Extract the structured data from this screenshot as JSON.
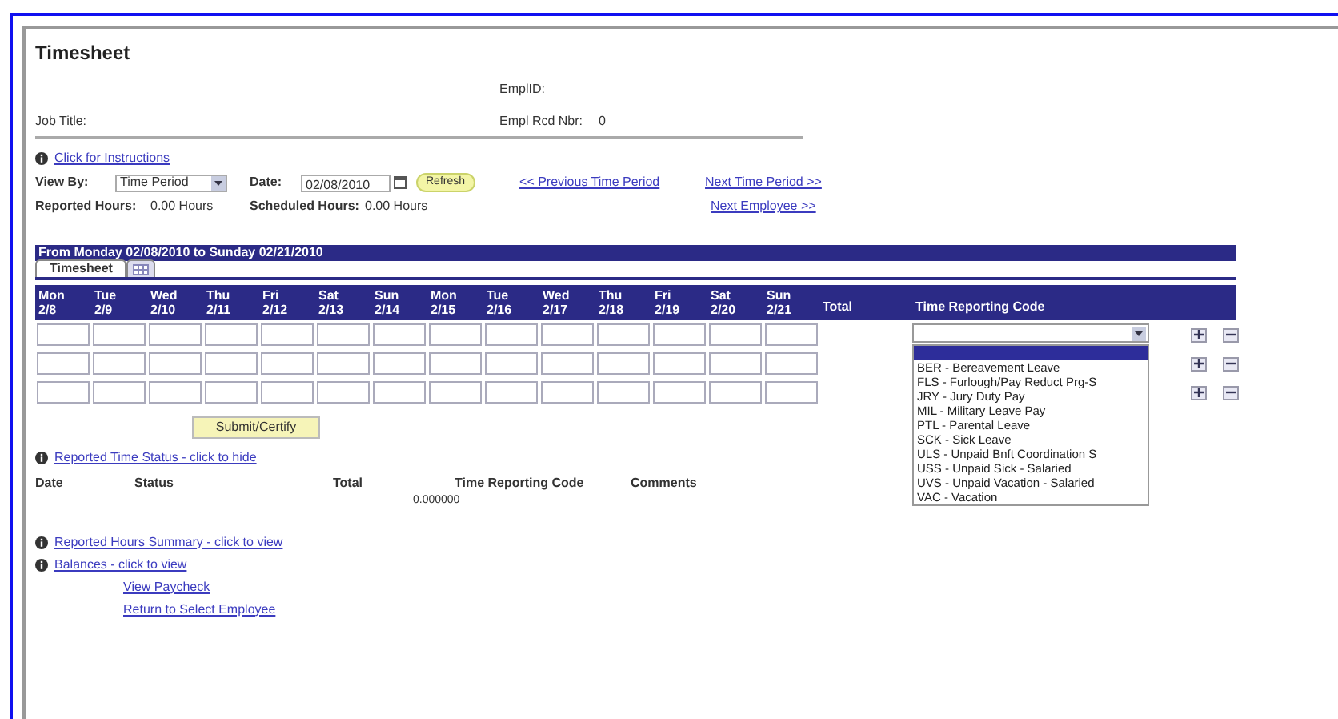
{
  "page": {
    "title": "Timesheet"
  },
  "employee": {
    "empl_id_label": "EmplID:",
    "job_title_label": "Job Title:",
    "empl_rcd_label": "Empl Rcd Nbr:",
    "empl_rcd_value": "0"
  },
  "instructions_link": "Click for Instructions",
  "controls": {
    "view_by_label": "View By:",
    "view_by_value": "Time Period",
    "date_label": "Date:",
    "date_value": "02/08/2010",
    "refresh_label": "Refresh",
    "previous_link": "<< Previous Time Period",
    "next_link": "Next Time Period >>",
    "reported_label": "Reported Hours:",
    "reported_value": "0.00 Hours",
    "scheduled_label": "Scheduled Hours:",
    "scheduled_value": "0.00 Hours",
    "next_employee_link": "Next Employee >>"
  },
  "period_banner": "From Monday 02/08/2010 to Sunday 02/21/2010",
  "tabs": [
    {
      "kind": "text",
      "label": "Timesheet",
      "selected": true
    },
    {
      "kind": "icon",
      "selected": false
    }
  ],
  "grid": {
    "days": [
      {
        "day": "Mon",
        "date": "2/8"
      },
      {
        "day": "Tue",
        "date": "2/9"
      },
      {
        "day": "Wed",
        "date": "2/10"
      },
      {
        "day": "Thu",
        "date": "2/11"
      },
      {
        "day": "Fri",
        "date": "2/12"
      },
      {
        "day": "Sat",
        "date": "2/13"
      },
      {
        "day": "Sun",
        "date": "2/14"
      },
      {
        "day": "Mon",
        "date": "2/15"
      },
      {
        "day": "Tue",
        "date": "2/16"
      },
      {
        "day": "Wed",
        "date": "2/17"
      },
      {
        "day": "Thu",
        "date": "2/18"
      },
      {
        "day": "Fri",
        "date": "2/19"
      },
      {
        "day": "Sat",
        "date": "2/20"
      },
      {
        "day": "Sun",
        "date": "2/21"
      }
    ],
    "total_header": "Total",
    "code_header": "Time Reporting Code",
    "rows": [
      {
        "dropdown_open": true
      },
      {
        "dropdown_open": false
      },
      {
        "dropdown_open": false
      }
    ],
    "code_options": [
      {
        "selected": true
      },
      {
        "label": "BER - Bereavement Leave",
        "selected": false
      },
      {
        "label": "FLS - Furlough/Pay Reduct Prg-S",
        "selected": false
      },
      {
        "label": "JRY - Jury Duty Pay",
        "selected": false
      },
      {
        "label": "MIL - Military Leave Pay",
        "selected": false
      },
      {
        "label": "PTL - Parental Leave",
        "selected": false
      },
      {
        "label": "SCK - Sick Leave",
        "selected": false
      },
      {
        "label": "ULS - Unpaid Bnft Coordination S",
        "selected": false
      },
      {
        "label": "USS - Unpaid Sick - Salaried",
        "selected": false
      },
      {
        "label": "UVS - Unpaid Vacation - Salaried",
        "selected": false
      },
      {
        "label": "VAC - Vacation",
        "selected": false
      }
    ]
  },
  "submit_button": "Submit/Certify",
  "status_section": {
    "link": "Reported Time Status - click to hide",
    "columns": [
      "Date",
      "Status",
      "Total",
      "Time Reporting Code",
      "Comments"
    ],
    "total_value": "0.000000"
  },
  "summary_links": [
    "Reported Hours Summary - click to view",
    "Balances - click to view"
  ],
  "bottom_links": [
    "View Paycheck",
    "Return to Select Employee"
  ]
}
